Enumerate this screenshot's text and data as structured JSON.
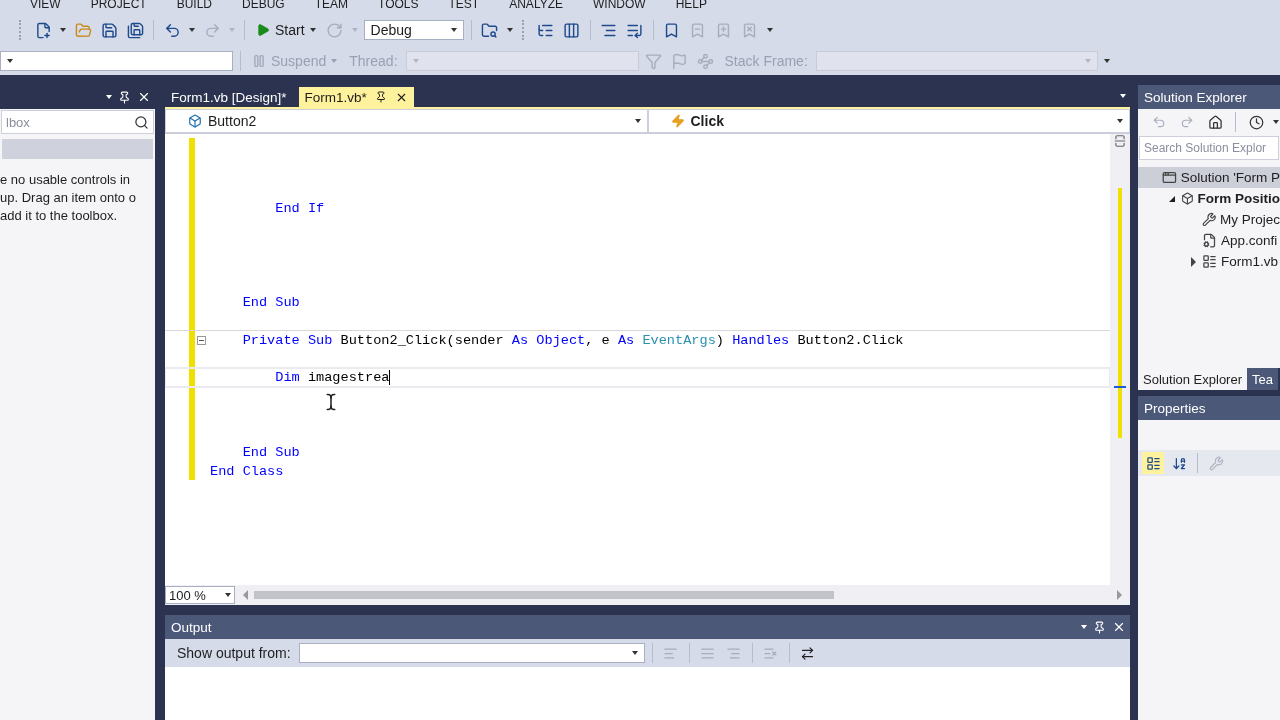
{
  "menu": [
    "VIEW",
    "PROJECT",
    "BUILD",
    "DEBUG",
    "TEAM",
    "TOOLS",
    "TEST",
    "ANALYZE",
    "WINDOW",
    "HELP"
  ],
  "toolbar": [
    {
      "kind": "grip"
    },
    {
      "kind": "new-project",
      "disabled": false
    },
    {
      "kind": "caret",
      "disabled": false
    },
    {
      "kind": "open",
      "disabled": false
    },
    {
      "kind": "save",
      "disabled": false
    },
    {
      "kind": "save-all",
      "disabled": false
    },
    {
      "kind": "separator"
    },
    {
      "kind": "undo",
      "disabled": false
    },
    {
      "kind": "caret",
      "disabled": false
    },
    {
      "kind": "redo",
      "disabled": true
    },
    {
      "kind": "caret",
      "disabled": true
    },
    {
      "kind": "separator"
    },
    {
      "kind": "start",
      "label": "Start",
      "disabled": false
    },
    {
      "kind": "refresh",
      "disabled": true
    },
    {
      "kind": "caret",
      "disabled": true
    },
    {
      "kind": "combo",
      "value": "Debug",
      "disabled": false
    },
    {
      "kind": "separator"
    },
    {
      "kind": "find",
      "disabled": false
    },
    {
      "kind": "overflow"
    },
    {
      "kind": "grip"
    },
    {
      "kind": "step-list",
      "disabled": false
    },
    {
      "kind": "columns",
      "disabled": false
    },
    {
      "kind": "separator"
    },
    {
      "kind": "lines",
      "disabled": false
    },
    {
      "kind": "lines-alt",
      "disabled": false
    },
    {
      "kind": "separator"
    },
    {
      "kind": "bookmark",
      "disabled": false
    },
    {
      "kind": "prev-bookmark",
      "disabled": true
    },
    {
      "kind": "next-bookmark",
      "disabled": true
    },
    {
      "kind": "clear-bookmark",
      "disabled": true
    },
    {
      "kind": "overflow"
    }
  ],
  "debug_toolbar": [
    {
      "kind": "combo",
      "disabled": false
    },
    {
      "kind": "separator"
    },
    {
      "kind": "suspend",
      "label": "Suspend",
      "disabled": true
    },
    {
      "kind": "label",
      "label": "Thread:",
      "disabled": true
    },
    {
      "kind": "combo",
      "disabled": true
    },
    {
      "kind": "filter",
      "disabled": true
    },
    {
      "kind": "flag",
      "disabled": true
    },
    {
      "kind": "threads",
      "disabled": true
    },
    {
      "kind": "label",
      "label": "Stack Frame:",
      "disabled": true
    },
    {
      "kind": "combo-wide",
      "disabled": true
    },
    {
      "kind": "overflow"
    }
  ],
  "toolbox": {
    "search_placeholder": "lbox",
    "message": "e no usable controls in up. Drag an item onto o add it to the toolbox."
  },
  "editor": {
    "tabs": [
      {
        "label": "Form1.vb [Design]*",
        "selected": false
      },
      {
        "label": "Form1.vb*",
        "selected": true
      }
    ],
    "type_combo": "Button2",
    "member_combo": "Click",
    "lines": [
      {
        "kind": "blank"
      },
      {
        "kind": "blank"
      },
      {
        "kind": "blank"
      },
      {
        "kind": "blank"
      },
      {
        "kind": "code",
        "current": false,
        "collapsible": false,
        "tokens": [
          {
            "kind": "keyword",
            "text": "        End If"
          }
        ]
      },
      {
        "kind": "blank"
      },
      {
        "kind": "blank"
      },
      {
        "kind": "blank"
      },
      {
        "kind": "blank"
      },
      {
        "kind": "code",
        "current": false,
        "collapsible": false,
        "tokens": [
          {
            "kind": "keyword",
            "text": "    End Sub"
          }
        ]
      },
      {
        "kind": "blank"
      },
      {
        "kind": "code",
        "current": false,
        "collapsible": true,
        "tokens": [
          {
            "kind": "keyword",
            "text": "    Private Sub"
          },
          {
            "kind": "plain",
            "text": " Button2_Click(sender "
          },
          {
            "kind": "keyword",
            "text": "As Object"
          },
          {
            "kind": "plain",
            "text": ", e "
          },
          {
            "kind": "keyword",
            "text": "As"
          },
          {
            "kind": "type",
            "text": " EventArgs"
          },
          {
            "kind": "plain",
            "text": ") "
          },
          {
            "kind": "keyword",
            "text": "Handles"
          },
          {
            "kind": "plain",
            "text": " Button2.Click"
          }
        ]
      },
      {
        "kind": "blank"
      },
      {
        "kind": "code",
        "current": true,
        "collapsible": false,
        "tokens": [
          {
            "kind": "keyword",
            "text": "        Dim"
          },
          {
            "kind": "plain",
            "text": " imagestrea"
          }
        ]
      },
      {
        "kind": "blank"
      },
      {
        "kind": "blank"
      },
      {
        "kind": "blank"
      },
      {
        "kind": "code",
        "current": false,
        "collapsible": false,
        "tokens": [
          {
            "kind": "keyword",
            "text": "    End Sub"
          }
        ]
      },
      {
        "kind": "code",
        "current": false,
        "collapsible": false,
        "tokens": [
          {
            "kind": "keyword",
            "text": "End Class"
          }
        ]
      }
    ],
    "zoom": "100 %"
  },
  "output": {
    "title": "Output",
    "show_from_label": "Show output from:"
  },
  "solution_explorer": {
    "title": "Solution Explorer",
    "search_placeholder": "Search Solution Explor",
    "tree": [
      {
        "kind": "solution",
        "label": "Solution 'Form P",
        "selected": true,
        "children": [
          {
            "kind": "project",
            "label": "Form Positio",
            "selected": false,
            "expanded": true,
            "children": [
              {
                "kind": "wrench",
                "label": "My Projec",
                "selected": false
              },
              {
                "kind": "config",
                "label": "App.confi",
                "selected": false
              },
              {
                "kind": "form",
                "label": "Form1.vb",
                "selected": false,
                "expanded": false
              }
            ]
          }
        ]
      }
    ],
    "tabs": [
      {
        "label": "Solution Explorer",
        "selected": true
      },
      {
        "label": "Tea",
        "selected": false
      }
    ]
  },
  "properties": {
    "title": "Properties",
    "buttons": [
      {
        "kind": "categorized",
        "selected": true,
        "disabled": false
      },
      {
        "kind": "alphabetical",
        "selected": false,
        "disabled": false
      },
      {
        "kind": "separator"
      },
      {
        "kind": "pages",
        "selected": false,
        "disabled": true
      }
    ]
  }
}
